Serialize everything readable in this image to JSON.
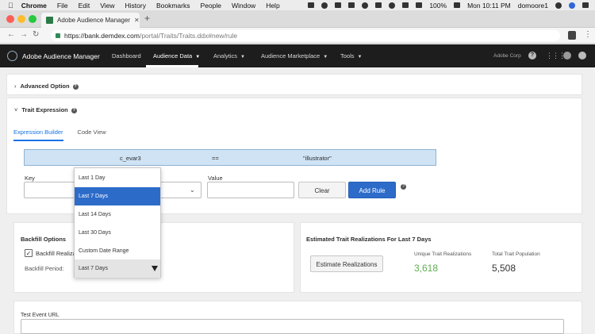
{
  "mac_menu": {
    "items": [
      "Chrome",
      "File",
      "Edit",
      "View",
      "History",
      "Bookmarks",
      "People",
      "Window",
      "Help"
    ],
    "battery": "100%",
    "clock": "Mon 10:11 PM",
    "user": "domoore1"
  },
  "browser": {
    "tab_title": "Adobe Audience Manager | Cre",
    "url_domain": "https://bank.demdex.com",
    "url_path": "/portal/Traits/Traits.ddx#new/rule"
  },
  "app": {
    "brand": "Adobe Audience Manager",
    "nav": [
      "Dashboard",
      "Audience Data",
      "Analytics",
      "Audience Marketplace",
      "Tools"
    ],
    "active_nav": "Audience Data",
    "org": "Adobe Corp"
  },
  "advanced": {
    "title": "Advanced Option"
  },
  "expression": {
    "title": "Trait Expression",
    "tabs": [
      "Expression Builder",
      "Code View"
    ],
    "rule": {
      "key": "c_evar3",
      "operator": "==",
      "value": "\"illustrator\""
    },
    "key_label": "Key",
    "value_label": "Value",
    "clear_label": "Clear",
    "add_rule_label": "Add Rule"
  },
  "backfill": {
    "title": "Backfill Options",
    "checkbox_label": "Backfill Realization",
    "period_label": "Backfill Period:",
    "period_selected": "Last 7 Days",
    "options": [
      "Last 1 Day",
      "Last 7 Days",
      "Last 14 Days",
      "Last 30 Days",
      "Custom Date Range",
      "Last 7 Days"
    ]
  },
  "estimate": {
    "title": "Estimated Trait Realizations For Last 7 Days",
    "button_label": "Estimate Realizations",
    "unique_label": "Unique Trait Realizations",
    "unique_value": "3,618",
    "total_label": "Total Trait Population",
    "total_value": "5,508"
  },
  "test_event": {
    "label": "Test Event URL"
  },
  "colors": {
    "accent": "#2d6bc9",
    "green_value": "#5fae4f",
    "header_bg": "#1d1d1d"
  }
}
